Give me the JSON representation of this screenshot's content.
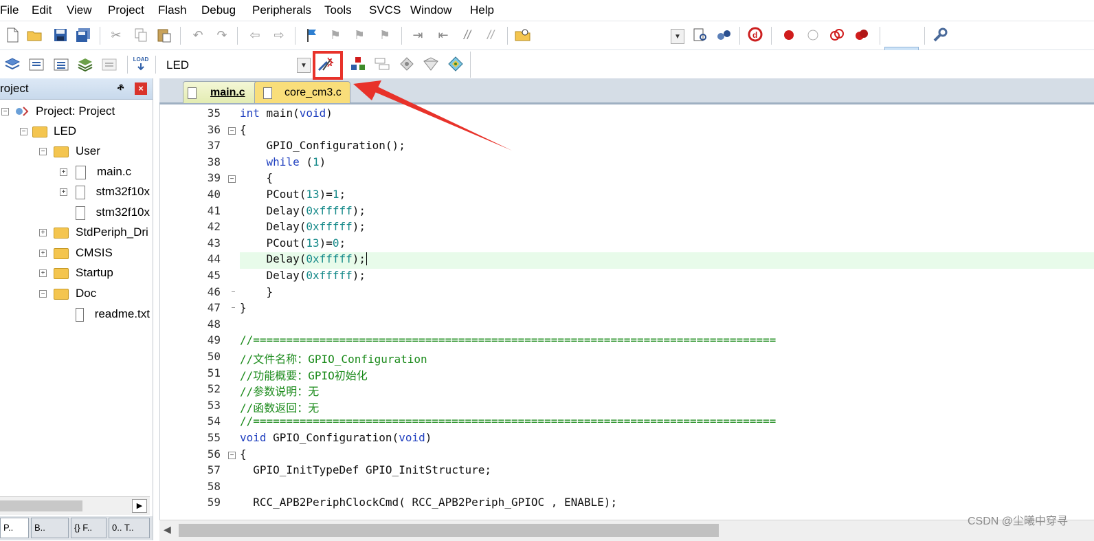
{
  "menu": [
    "File",
    "Edit",
    "View",
    "Project",
    "Flash",
    "Debug",
    "Peripherals",
    "Tools",
    "SVCS",
    "Window",
    "Help"
  ],
  "toolbar2": {
    "target_value": "LED",
    "load_label": "LOAD"
  },
  "project_panel": {
    "title": "roject",
    "tree": [
      {
        "label": "Project: Project"
      },
      {
        "label": "LED"
      },
      {
        "label": "User"
      },
      {
        "label": "main.c"
      },
      {
        "label": "stm32f10x"
      },
      {
        "label": "stm32f10x"
      },
      {
        "label": "StdPeriph_Dri"
      },
      {
        "label": "CMSIS"
      },
      {
        "label": "Startup"
      },
      {
        "label": "Doc"
      },
      {
        "label": "readme.txt"
      }
    ],
    "bottom_tabs": [
      "P..",
      "B..",
      "{} F..",
      "0.. T.."
    ]
  },
  "tabs": [
    {
      "label": "main.c",
      "active": true
    },
    {
      "label": "core_cm3.c",
      "active": false
    }
  ],
  "editor": {
    "lines": [
      {
        "n": "35",
        "text": "int main(void)"
      },
      {
        "n": "36",
        "text": "{"
      },
      {
        "n": "37",
        "text": "    GPIO_Configuration();"
      },
      {
        "n": "38",
        "text": "    while (1)"
      },
      {
        "n": "39",
        "text": "    {"
      },
      {
        "n": "40",
        "text": "    PCout(13)=1;"
      },
      {
        "n": "41",
        "text": "    Delay(0xfffff);"
      },
      {
        "n": "42",
        "text": "    Delay(0xfffff);"
      },
      {
        "n": "43",
        "text": "    PCout(13)=0;"
      },
      {
        "n": "44",
        "text": "    Delay(0xfffff);"
      },
      {
        "n": "45",
        "text": "    Delay(0xfffff);"
      },
      {
        "n": "46",
        "text": "    }"
      },
      {
        "n": "47",
        "text": "}"
      },
      {
        "n": "48",
        "text": ""
      },
      {
        "n": "49",
        "text": "//==============================================================================="
      },
      {
        "n": "50",
        "text": "//文件名称：GPIO_Configuration"
      },
      {
        "n": "51",
        "text": "//功能概要：GPIO初始化"
      },
      {
        "n": "52",
        "text": "//参数说明：无"
      },
      {
        "n": "53",
        "text": "//函数返回：无"
      },
      {
        "n": "54",
        "text": "//==============================================================================="
      },
      {
        "n": "55",
        "text": "void GPIO_Configuration(void)"
      },
      {
        "n": "56",
        "text": "{"
      },
      {
        "n": "57",
        "text": "  GPIO_InitTypeDef GPIO_InitStructure;"
      },
      {
        "n": "58",
        "text": ""
      },
      {
        "n": "59",
        "text": "  RCC_APB2PeriphClockCmd( RCC_APB2Periph_GPIOC , ENABLE);"
      }
    ]
  },
  "watermark": "CSDN @尘曦中穿寻",
  "colors": {
    "keyword": "#1f3fbf",
    "number": "#168a8a",
    "comment": "#1a8a1a",
    "annotation": "#e8322a",
    "current_line": "#e8fbea"
  }
}
